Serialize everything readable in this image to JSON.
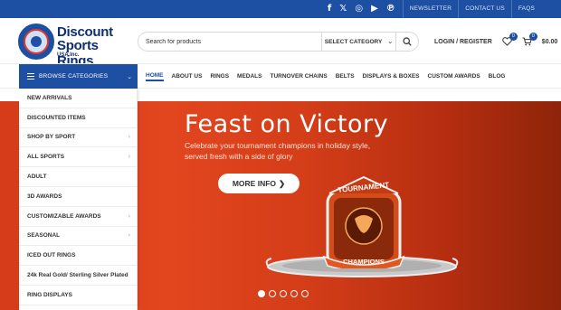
{
  "topbar": {
    "social": [
      {
        "icon": "facebook-icon",
        "glyph": "f"
      },
      {
        "icon": "x-twitter-icon",
        "glyph": "𝕏"
      },
      {
        "icon": "instagram-icon",
        "glyph": "◎"
      },
      {
        "icon": "youtube-icon",
        "glyph": "▶"
      },
      {
        "icon": "pinterest-icon",
        "glyph": "℗"
      }
    ],
    "links": [
      "NEWSLETTER",
      "CONTACT US",
      "FAQS"
    ]
  },
  "logo": {
    "line1": "Discount",
    "line2": "Sports Rings",
    "line3": "USA Inc."
  },
  "search": {
    "placeholder": "Search for products",
    "category": "SELECT CATEGORY"
  },
  "header": {
    "login": "LOGIN / REGISTER",
    "wishlist_count": "0",
    "cart_count": "0",
    "cart_total": "$0.00"
  },
  "browse": {
    "label": "BROWSE CATEGORIES"
  },
  "nav": [
    "HOME",
    "ABOUT US",
    "RINGS",
    "MEDALS",
    "TURNOVER CHAINS",
    "BELTS",
    "DISPLAYS & BOXES",
    "CUSTOM AWARDS",
    "BLOG"
  ],
  "categories": [
    {
      "label": "NEW ARRIVALS",
      "sub": false
    },
    {
      "label": "DISCOUNTED ITEMS",
      "sub": false
    },
    {
      "label": "SHOP BY SPORT",
      "sub": true
    },
    {
      "label": "ALL SPORTS",
      "sub": true
    },
    {
      "label": "ADULT",
      "sub": false
    },
    {
      "label": "3D AWARDS",
      "sub": false
    },
    {
      "label": "CUSTOMIZABLE AWARDS",
      "sub": true
    },
    {
      "label": "SEASONAL",
      "sub": true
    },
    {
      "label": "ICED OUT RINGS",
      "sub": false
    },
    {
      "label": "24k Real Gold/ Sterling Silver Plated",
      "sub": false
    },
    {
      "label": "RING DISPLAYS",
      "sub": false
    }
  ],
  "hero": {
    "title": "Feast on Victory",
    "subtitle": "Celebrate your tournament champions in holiday style, served fresh with a side of glory",
    "button": "MORE INFO",
    "ring_text_top": "TOURNAMENT",
    "ring_text_bottom": "CHAMPIONS",
    "slides": 5,
    "active_slide": 1
  },
  "colors": {
    "brand": "#1d4fa3",
    "hero_start": "#d63b1a",
    "hero_end": "#8e2409"
  }
}
